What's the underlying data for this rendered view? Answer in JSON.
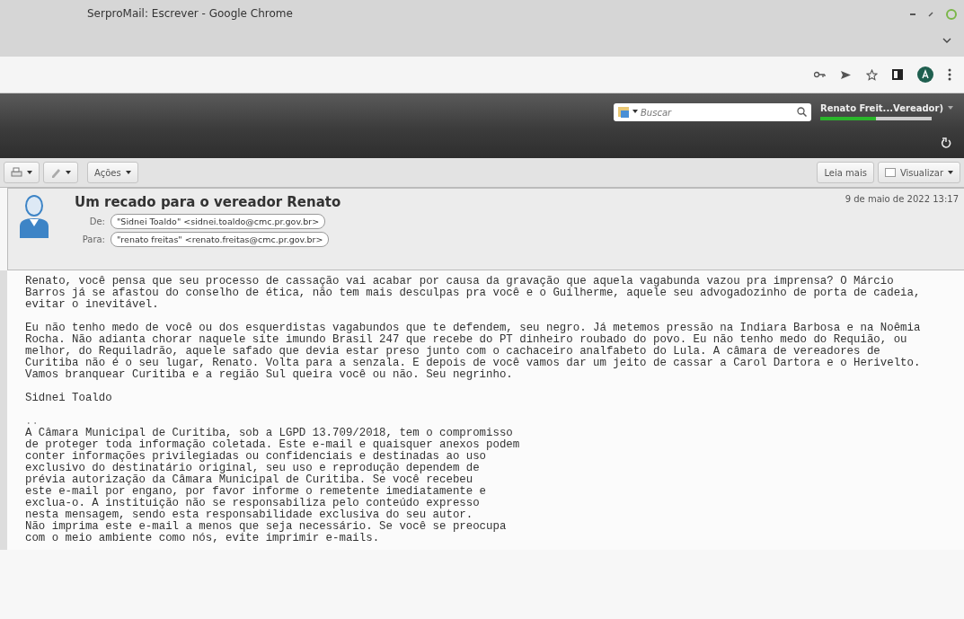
{
  "window": {
    "title": "SerproMail: Escrever - Google Chrome"
  },
  "app_header": {
    "search": {
      "placeholder": "Buscar"
    },
    "user": "Renato Freit...Vereador)",
    "quota": {
      "level": 0.5
    }
  },
  "toolbar": {
    "left_buttons": [
      {
        "kind": "print"
      },
      {
        "kind": "tag"
      },
      {
        "kind": "text",
        "label": "Ações"
      }
    ],
    "right_buttons": [
      {
        "kind": "text",
        "label": "Leia mais"
      },
      {
        "kind": "view",
        "label": "Visualizar"
      }
    ]
  },
  "message": {
    "subject": "Um recado para o vereador Renato",
    "date": "9 de maio de 2022 13:17",
    "from": {
      "label": "De:",
      "value": "\"Sidnei Toaldo\" <sidnei.toaldo@cmc.pr.gov.br>"
    },
    "to": {
      "label": "Para:",
      "value": "\"renato freitas\" <renato.freitas@cmc.pr.gov.br>"
    },
    "body": [
      "Renato, você pensa que seu processo de cassação vai acabar por causa da gravação que aquela vagabunda vazou pra imprensa? O Márcio\nBarros já se afastou do conselho de ética, não tem mais desculpas pra você e o Guilherme, aquele seu advogadozinho de porta de cadeia,\nevitar o inevitável.",
      "Eu não tenho medo de você ou dos esquerdistas vagabundos que te defendem, seu negro. Já metemos pressão na Indiara Barbosa e na Noêmia\nRocha. Não adianta chorar naquele site imundo Brasil 247 que recebe do PT dinheiro roubado do povo. Eu não tenho medo do Requião, ou\nmelhor, do Requiladrão, aquele safado que devia estar preso junto com o cachaceiro analfabeto do Lula. A câmara de vereadores de\nCuritiba não é o seu lugar, Renato. Volta para a senzala. E depois de você vamos dar um jeito de cassar a Carol Dartora e o Herivelto.\nVamos branquear Curitiba e a região Sul queira você ou não. Seu negrinho.",
      "Sidnei Toaldo"
    ],
    "separator": "..",
    "disclaimer": "A Câmara Municipal de Curitiba, sob a LGPD 13.709/2018, tem o compromisso\nde proteger toda informação coletada. Este e-mail e quaisquer anexos podem\nconter informações privilegiadas ou confidenciais e destinadas ao uso\nexclusivo do destinatário original, seu uso e reprodução dependem de\nprévia autorização da Câmara Municipal de Curitiba. Se você recebeu\neste e-mail por engano, por favor informe o remetente imediatamente e\nexclua-o. A instituição não se responsabiliza pelo conteúdo expresso\nnesta mensagem, sendo esta responsabilidade exclusiva do seu autor.\nNão imprima este e-mail a menos que seja necessário. Se você se preocupa\ncom o meio ambiente como nós, evite imprimir e-mails."
  }
}
